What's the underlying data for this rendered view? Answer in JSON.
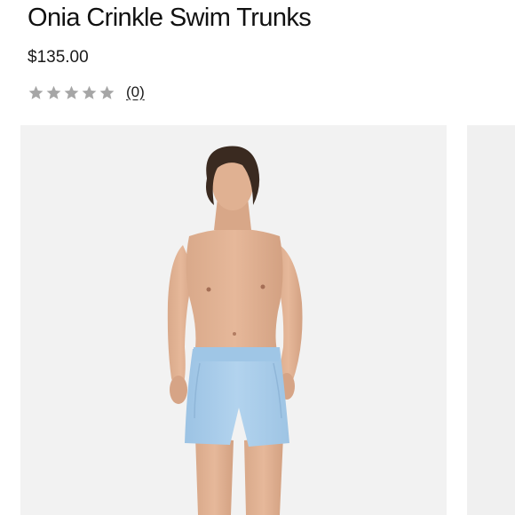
{
  "product": {
    "title": "Onia Crinkle Swim Trunks",
    "price": "$135.00",
    "rating": {
      "value": 0,
      "max": 5,
      "review_count_label": "(0)"
    }
  },
  "gallery": {
    "main_image": "man-in-light-blue-swim-trunks",
    "next_image": "next-product-photo-partial"
  },
  "colors": {
    "star_empty": "#a6a6a6",
    "trunks": "#a9cdea",
    "background": "#f2f2f2"
  }
}
